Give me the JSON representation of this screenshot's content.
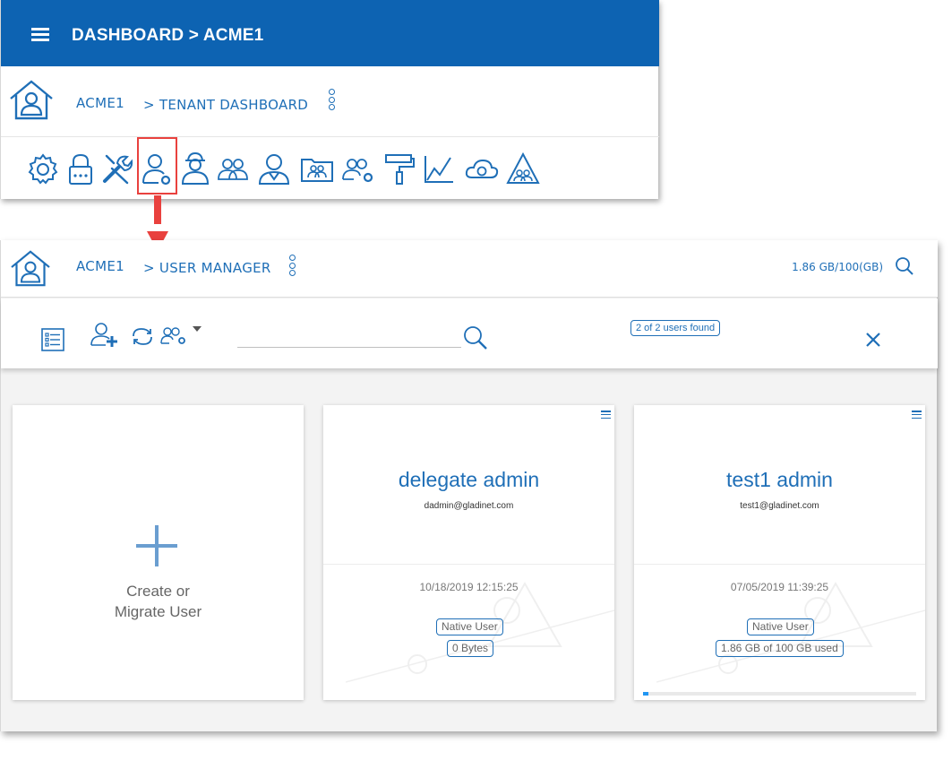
{
  "top_panel": {
    "title": "DASHBOARD > ACME1",
    "breadcrumb": {
      "tenant": "ACME1",
      "current": "> TENANT DASHBOARD"
    },
    "toolbar_icons": [
      "gear-icon",
      "lock-icon",
      "tools-icon",
      "user-manager-icon",
      "agent-user-icon",
      "group-icon",
      "admin-user-icon",
      "team-folder-icon",
      "group-settings-icon",
      "paint-roller-icon",
      "chart-icon",
      "cloud-storage-icon",
      "warning-triangle-icon"
    ],
    "highlighted_icon": "user-manager-icon"
  },
  "bottom_panel": {
    "breadcrumb": {
      "tenant": "ACME1",
      "current": "> USER MANAGER"
    },
    "quota": "1.86 GB/100(GB)",
    "search": {
      "value": "",
      "placeholder": ""
    },
    "found": "2 of 2 users found",
    "cards": {
      "create": {
        "label": "Create or Migrate User"
      },
      "users": [
        {
          "name": "delegate admin",
          "email": "dadmin@gladinet.com",
          "date": "10/18/2019 12:15:25",
          "type": "Native User",
          "usage": "0 Bytes"
        },
        {
          "name": "test1 admin",
          "email": "test1@gladinet.com",
          "date": "07/05/2019 11:39:25",
          "type": "Native User",
          "usage": "1.86 GB of 100 GB used",
          "usage_fraction": 0.0186
        }
      ]
    }
  },
  "colors": {
    "brand_blue": "#0d63b2",
    "link_blue": "#1f6fb7",
    "highlight_red": "#e9413e",
    "usage_fill": "#2196f3"
  }
}
